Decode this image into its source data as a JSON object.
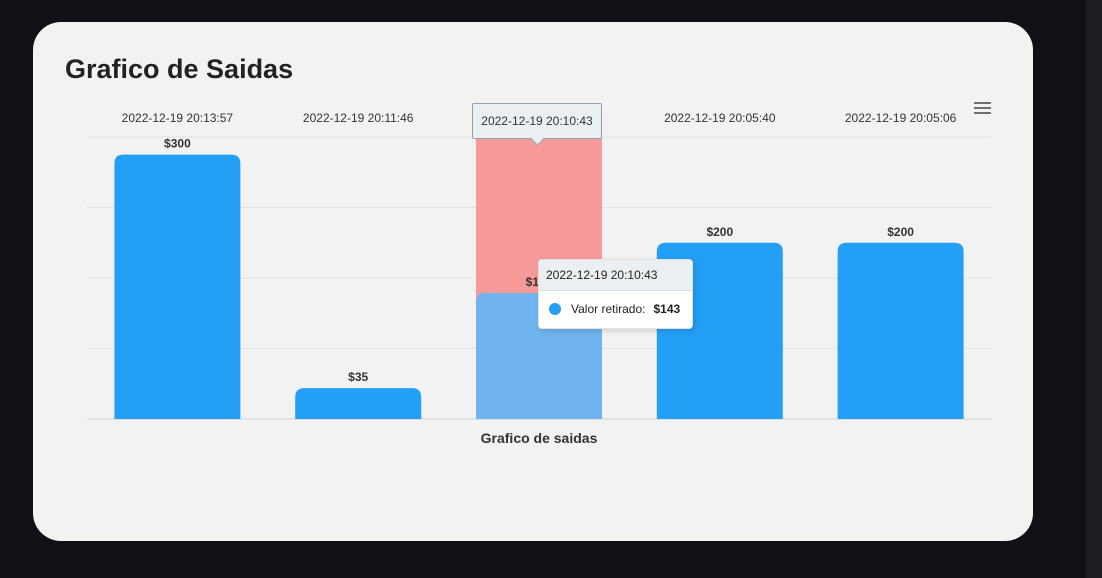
{
  "card": {
    "title": "Grafico de Saidas"
  },
  "chart_data": {
    "type": "bar",
    "categories": [
      "2022-12-19 20:13:57",
      "2022-12-19 20:11:46",
      "2022-12-19 20:10:43",
      "2022-12-19 20:05:40",
      "2022-12-19 20:05:06"
    ],
    "series": [
      {
        "name": "Valor retirado",
        "values": [
          300,
          35,
          143,
          200,
          200
        ]
      }
    ],
    "data_labels": [
      "$300",
      "$35",
      "$143",
      "$200",
      "$200"
    ],
    "xlabel": "Grafico de saidas",
    "ylabel": "",
    "ylim": [
      0,
      320
    ],
    "x_axis_position": "top",
    "y_axis_labels_visible": false,
    "grid": true,
    "highlighted_index": 2,
    "colors": {
      "bar": "#239ff6",
      "bar_hover": "#6fb4ee",
      "hover_band": "#f99a9a"
    }
  },
  "axis_tooltip": {
    "text": "2022-12-19 20:10:43"
  },
  "tooltip": {
    "title": "2022-12-19 20:10:43",
    "series_label": "Valor retirado:",
    "value": "$143"
  },
  "toolbar": {
    "menu_icon": "hamburger-menu-icon"
  }
}
